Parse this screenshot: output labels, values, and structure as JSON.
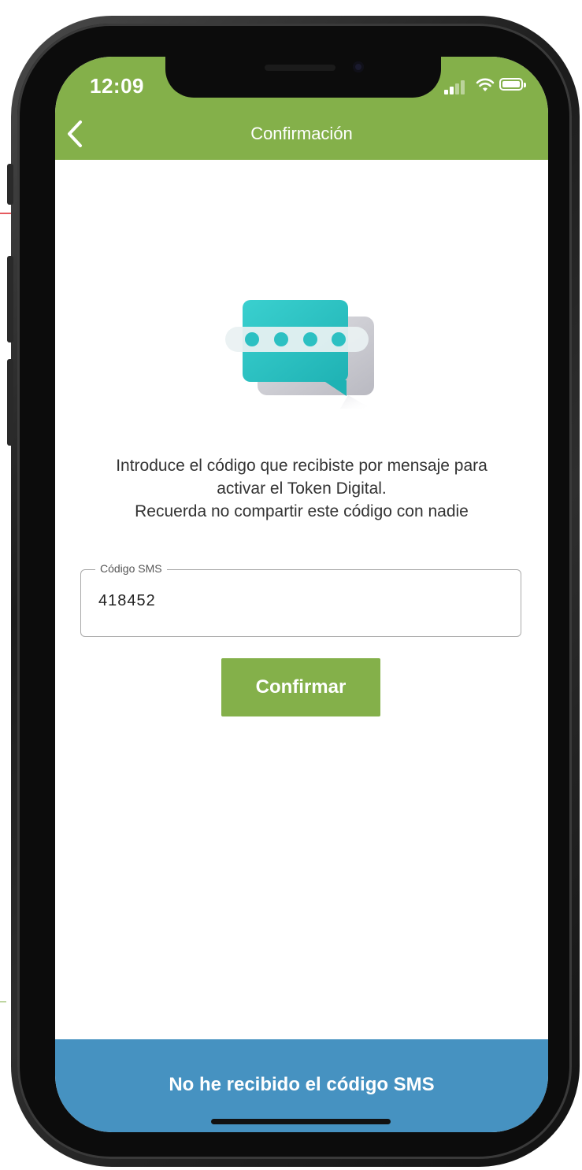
{
  "status_bar": {
    "time": "12:09",
    "signal_icon": "signal-bars-icon",
    "wifi_icon": "wifi-icon",
    "battery_icon": "battery-icon"
  },
  "header": {
    "title": "Confirmación",
    "back_icon": "chevron-left-icon",
    "background_color": "#84b04a"
  },
  "illustration": {
    "icon": "sms-code-chat-bubble-icon"
  },
  "message": {
    "lines": [
      "Introduce el código que recibiste por mensaje para",
      "activar el Token Digital.",
      "Recuerda no compartir este código con nadie"
    ]
  },
  "sms_field": {
    "label": "Código SMS",
    "value": "418452"
  },
  "confirm_button": {
    "label": "Confirmar",
    "color": "#84b04a"
  },
  "footer": {
    "label": "No he recibido el código SMS",
    "color": "#4692c1"
  }
}
